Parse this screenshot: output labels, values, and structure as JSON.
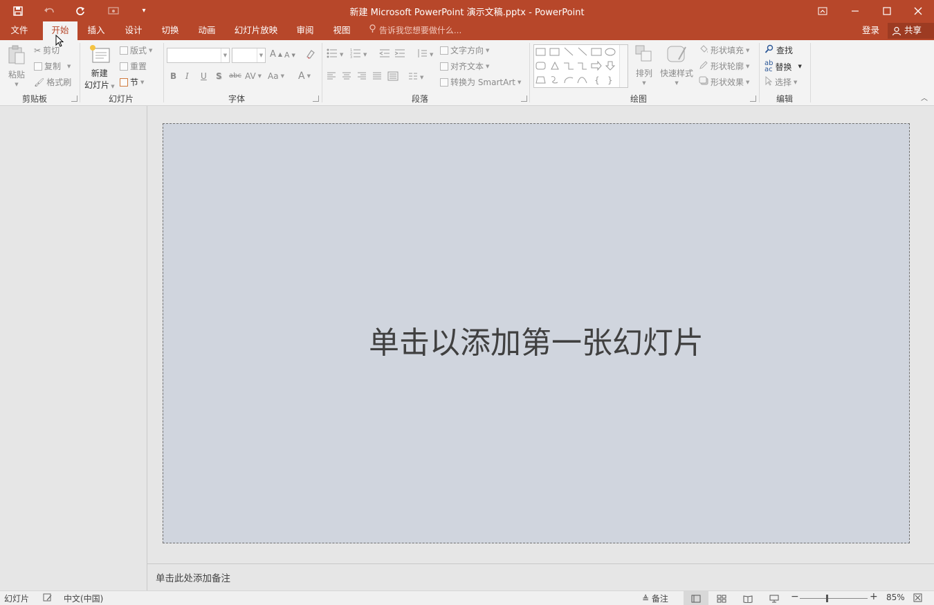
{
  "window": {
    "title": "新建 Microsoft PowerPoint 演示文稿.pptx - PowerPoint"
  },
  "quick_access": [
    {
      "name": "save-icon",
      "glyph": "💾"
    },
    {
      "name": "undo-icon",
      "glyph": "↶"
    },
    {
      "name": "redo-icon",
      "glyph": "↻"
    },
    {
      "name": "start-from-beginning-icon",
      "glyph": "⊙"
    },
    {
      "name": "customize-icon",
      "glyph": "▾"
    }
  ],
  "tabs": [
    {
      "label": "文件"
    },
    {
      "label": "开始"
    },
    {
      "label": "插入"
    },
    {
      "label": "设计"
    },
    {
      "label": "切换"
    },
    {
      "label": "动画"
    },
    {
      "label": "幻灯片放映"
    },
    {
      "label": "审阅"
    },
    {
      "label": "视图"
    }
  ],
  "active_tab": "开始",
  "tell_me": "告诉我您想要做什么...",
  "account": {
    "login": "登录",
    "share": "共享"
  },
  "ribbon": {
    "clipboard": {
      "paste": "粘贴",
      "cut": "剪切",
      "copy": "复制",
      "format_painter": "格式刷",
      "label": "剪贴板"
    },
    "slides": {
      "new_slide_line1": "新建",
      "new_slide_line2": "幻灯片",
      "layout": "版式",
      "reset": "重置",
      "section": "节",
      "label": "幻灯片"
    },
    "font": {
      "bold": "B",
      "italic": "I",
      "underline": "U",
      "shadow": "S",
      "strikethrough": "abc",
      "spacing": "AV",
      "case": "Aa",
      "color": "A",
      "grow": "A",
      "shrink": "A",
      "label": "字体"
    },
    "paragraph": {
      "text_direction": "文字方向",
      "align_text": "对齐文本",
      "smartart": "转换为 SmartArt",
      "label": "段落"
    },
    "drawing": {
      "arrange": "排列",
      "quick_styles": "快速样式",
      "shape_fill": "形状填充",
      "shape_outline": "形状轮廓",
      "shape_effects": "形状效果",
      "label": "绘图"
    },
    "editing": {
      "find": "查找",
      "replace": "替换",
      "select": "选择",
      "label": "编辑"
    }
  },
  "slide": {
    "placeholder": "单击以添加第一张幻灯片"
  },
  "notes": {
    "placeholder": "单击此处添加备注"
  },
  "status": {
    "slide": "幻灯片",
    "language": "中文(中国)",
    "notes": "备注",
    "zoom": "85%"
  },
  "colors": {
    "accent": "#b7472a",
    "slide_bg": "#d0d5de"
  }
}
